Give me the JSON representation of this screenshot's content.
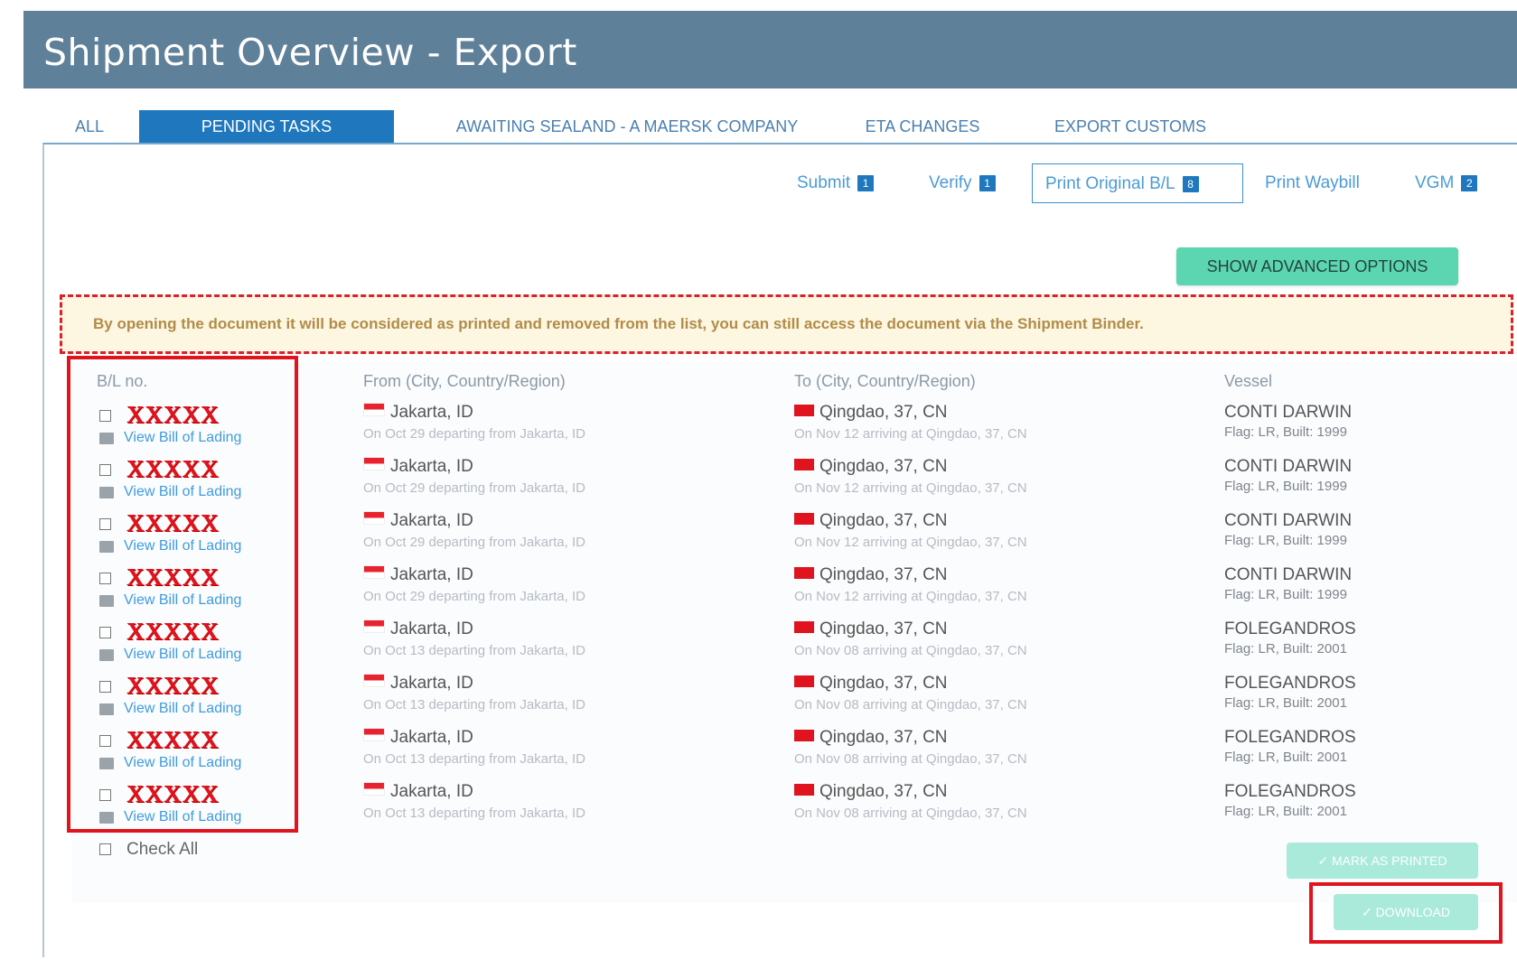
{
  "header": {
    "title": "Shipment Overview - Export"
  },
  "tabs": [
    {
      "label": "ALL"
    },
    {
      "label": "PENDING TASKS"
    },
    {
      "label": "AWAITING SEALAND - A MAERSK COMPANY"
    },
    {
      "label": "ETA CHANGES"
    },
    {
      "label": "EXPORT CUSTOMS"
    }
  ],
  "subtabs": [
    {
      "label": "Submit",
      "count": "1"
    },
    {
      "label": "Verify",
      "count": "1"
    },
    {
      "label": "Print Original B/L",
      "count": "8"
    },
    {
      "label": "Print Waybill",
      "count": ""
    },
    {
      "label": "VGM",
      "count": "2"
    }
  ],
  "actions": {
    "advanced_options": "SHOW ADVANCED OPTIONS",
    "mark_as_printed": "✓ MARK AS PRINTED",
    "download": "✓ DOWNLOAD",
    "check_all": "Check All"
  },
  "notice": "By opening the document it will be considered as printed and removed from the list, you can still access the document via the Shipment Binder.",
  "columns": {
    "bl": "B/L no.",
    "from": "From (City, Country/Region)",
    "to": "To (City, Country/Region)",
    "vessel": "Vessel"
  },
  "rows": [
    {
      "bl": "XXXXX",
      "link": "View Bill of Lading",
      "from": "Jakarta, ID",
      "from_sub": "On Oct 29 departing from Jakarta, ID",
      "to": "Qingdao, 37, CN",
      "to_sub": "On Nov 12 arriving at Qingdao, 37, CN",
      "vessel": "CONTI DARWIN",
      "flag": "Flag: LR, Built: 1999"
    },
    {
      "bl": "XXXXX",
      "link": "View Bill of Lading",
      "from": "Jakarta, ID",
      "from_sub": "On Oct 29 departing from Jakarta, ID",
      "to": "Qingdao, 37, CN",
      "to_sub": "On Nov 12 arriving at Qingdao, 37, CN",
      "vessel": "CONTI DARWIN",
      "flag": "Flag: LR, Built: 1999"
    },
    {
      "bl": "XXXXX",
      "link": "View Bill of Lading",
      "from": "Jakarta, ID",
      "from_sub": "On Oct 29 departing from Jakarta, ID",
      "to": "Qingdao, 37, CN",
      "to_sub": "On Nov 12 arriving at Qingdao, 37, CN",
      "vessel": "CONTI DARWIN",
      "flag": "Flag: LR, Built: 1999"
    },
    {
      "bl": "XXXXX",
      "link": "View Bill of Lading",
      "from": "Jakarta, ID",
      "from_sub": "On Oct 29 departing from Jakarta, ID",
      "to": "Qingdao, 37, CN",
      "to_sub": "On Nov 12 arriving at Qingdao, 37, CN",
      "vessel": "CONTI DARWIN",
      "flag": "Flag: LR, Built: 1999"
    },
    {
      "bl": "XXXXX",
      "link": "View Bill of Lading",
      "from": "Jakarta, ID",
      "from_sub": "On Oct 13 departing from Jakarta, ID",
      "to": "Qingdao, 37, CN",
      "to_sub": "On Nov 08 arriving at Qingdao, 37, CN",
      "vessel": "FOLEGANDROS",
      "flag": "Flag: LR, Built: 2001"
    },
    {
      "bl": "XXXXX",
      "link": "View Bill of Lading",
      "from": "Jakarta, ID",
      "from_sub": "On Oct 13 departing from Jakarta, ID",
      "to": "Qingdao, 37, CN",
      "to_sub": "On Nov 08 arriving at Qingdao, 37, CN",
      "vessel": "FOLEGANDROS",
      "flag": "Flag: LR, Built: 2001"
    },
    {
      "bl": "XXXXX",
      "link": "View Bill of Lading",
      "from": "Jakarta, ID",
      "from_sub": "On Oct 13 departing from Jakarta, ID",
      "to": "Qingdao, 37, CN",
      "to_sub": "On Nov 08 arriving at Qingdao, 37, CN",
      "vessel": "FOLEGANDROS",
      "flag": "Flag: LR, Built: 2001"
    },
    {
      "bl": "XXXXX",
      "link": "View Bill of Lading",
      "from": "Jakarta, ID",
      "from_sub": "On Oct 13 departing from Jakarta, ID",
      "to": "Qingdao, 37, CN",
      "to_sub": "On Nov 08 arriving at Qingdao, 37, CN",
      "vessel": "FOLEGANDROS",
      "flag": "Flag: LR, Built: 2001"
    }
  ]
}
